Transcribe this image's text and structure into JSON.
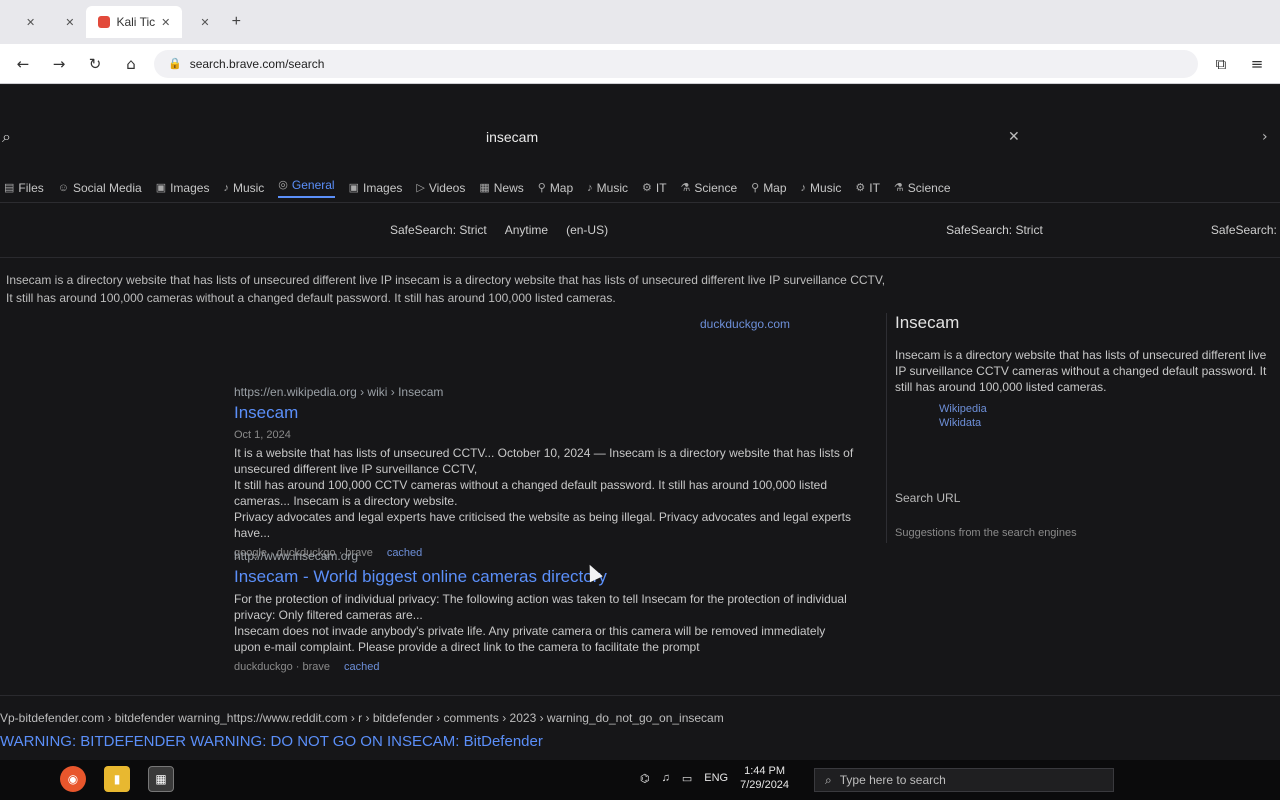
{
  "browser": {
    "tabs": [
      {
        "label": ""
      },
      {
        "label": ""
      },
      {
        "label": "Kali Tic",
        "active": true
      },
      {
        "label": ""
      }
    ],
    "url": "search.brave.com/search",
    "nav_icons": [
      "back-icon",
      "forward-icon",
      "reload-icon",
      "home-icon"
    ]
  },
  "search": {
    "query": "insecam",
    "verticals": [
      {
        "label": "Files",
        "icon": "folder"
      },
      {
        "label": "Social Media",
        "icon": "people"
      },
      {
        "label": "Images",
        "icon": "image"
      },
      {
        "label": "Music",
        "icon": "music"
      },
      {
        "label": "General",
        "icon": "globe",
        "active": true
      },
      {
        "label": "Images",
        "icon": "image"
      },
      {
        "label": "Videos",
        "icon": "video"
      },
      {
        "label": "News",
        "icon": "news"
      },
      {
        "label": "Map",
        "icon": "map"
      },
      {
        "label": "Music",
        "icon": "music"
      },
      {
        "label": "IT",
        "icon": "chip"
      },
      {
        "label": "Science",
        "icon": "flask"
      },
      {
        "label": "Map",
        "icon": "map"
      },
      {
        "label": "Music",
        "icon": "music"
      },
      {
        "label": "IT",
        "icon": "chip"
      },
      {
        "label": "Science",
        "icon": "flask"
      }
    ],
    "filters": [
      "SafeSearch: Strict",
      "Anytime",
      "(en-US)",
      "SafeSearch: Strict",
      "SafeSearch: Strict"
    ]
  },
  "snippet": {
    "line1": "Insecam is a directory website that has lists of unsecured different live IP insecam is a directory website that has lists of unsecured different live IP surveillance CCTV,",
    "line2": "It still has around 100,000 cameras without a changed default password. It still has around 100,000 listed cameras.",
    "source": "duckduckgo.com"
  },
  "results": [
    {
      "url": "https://en.wikipedia.org › wiki › Insecam",
      "title": "Insecam",
      "date": "Oct 1, 2024",
      "desc1": "It is a website that has lists of unsecured CCTV... October 10, 2024 — Insecam is a directory website that has lists of unsecured different live IP surveillance CCTV,",
      "desc2": "It still has around 100,000 CCTV cameras without a changed default password. It still has around 100,000 listed cameras... Insecam is a directory website.",
      "desc3": "Privacy advocates and legal experts have criticised the website as being illegal. Privacy advocates and legal experts have...",
      "engine": "google · duckduckgo · brave",
      "cached": "cached"
    },
    {
      "url": "http://www.insecam.org",
      "title": "Insecam - World biggest online cameras directory",
      "desc1": "For the protection of individual privacy: The following action was taken to tell Insecam for the protection of individual privacy: Only filtered cameras are...",
      "desc2": "Insecam does not invade anybody's private life. Any private camera or this camera will be removed immediately upon e-mail complaint. Please provide a direct link to the camera to facilitate the prompt",
      "engine": "duckduckgo · brave",
      "cached": "cached"
    }
  ],
  "infobox": {
    "title": "Insecam",
    "text": "Insecam is a directory website that has lists of unsecured different live IP surveillance CCTV cameras without a changed default password. It still has around 100,000 listed cameras.",
    "links": [
      "Wikipedia",
      "Wikidata"
    ],
    "search_url": "Search URL",
    "footer": "Suggestions from the search engines"
  },
  "ad": {
    "line": "Vp-bitdefender.com › bitdefender warning_https://www.reddit.com › r › bitdefender › comments › 2023 › warning_do_not_go_on_insecam",
    "title": "WARNING: BITDEFENDER WARNING: DO NOT GO ON INSECAM: BitDefender"
  },
  "taskbar": {
    "search_placeholder": "Type here to search",
    "lang": "ENG",
    "time": "1:44 PM",
    "date": "7/29/2024"
  }
}
